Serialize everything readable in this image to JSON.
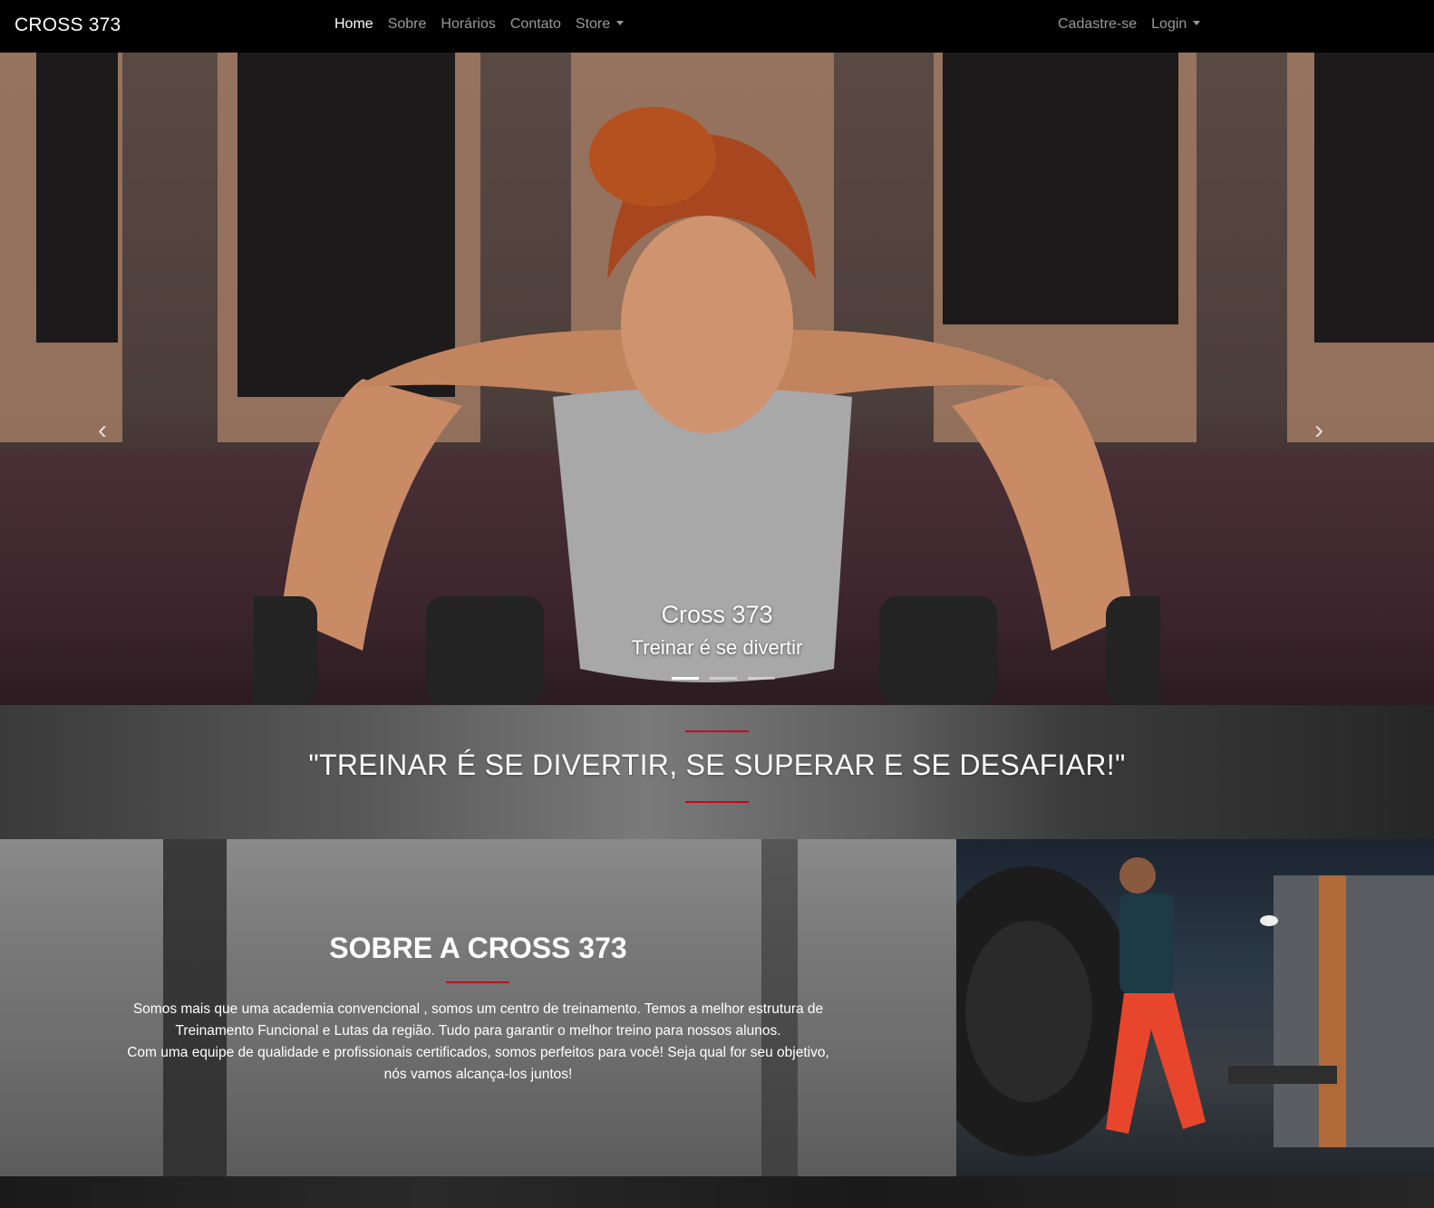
{
  "navbar": {
    "brand": "CROSS 373",
    "items": [
      {
        "label": "Home"
      },
      {
        "label": "Sobre"
      },
      {
        "label": "Horários"
      },
      {
        "label": "Contato"
      },
      {
        "label": "Store"
      }
    ],
    "right": [
      {
        "label": "Cadastre-se"
      },
      {
        "label": "Login"
      }
    ]
  },
  "hero": {
    "caption_title": "Cross 373",
    "caption_text": "Treinar é se divertir",
    "prev_icon": "chevron-left-icon",
    "next_icon": "chevron-right-icon",
    "slides": 3,
    "active_slide": 1
  },
  "quote": {
    "text": "\"TREINAR É SE DIVERTIR, SE SUPERAR E SE DESAFIAR!\"",
    "accent_color": "#d0021b"
  },
  "about": {
    "title": "SOBRE A CROSS 373",
    "lines": [
      "Somos mais que uma academia convencional , somos um centro de treinamento. Temos a melhor estrutura de",
      "Treinamento Funcional e Lutas da região. Tudo para garantir o melhor treino para nossos alunos.",
      "Com uma equipe de qualidade e profissionais certificados, somos perfeitos para você! Seja qual for seu objetivo,",
      "nós vamos alcança-los juntos!"
    ]
  }
}
